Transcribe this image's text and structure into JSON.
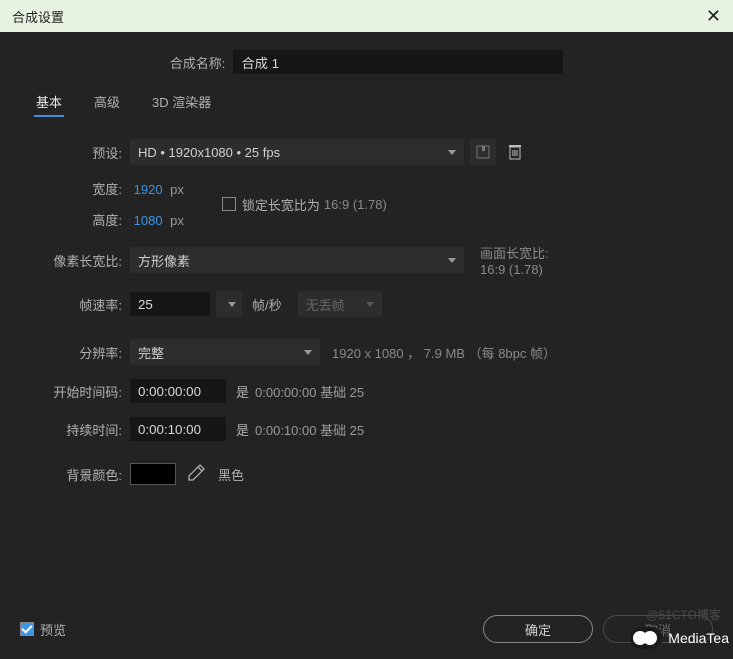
{
  "titlebar": {
    "title": "合成设置"
  },
  "compName": {
    "label": "合成名称:",
    "value": "合成 1"
  },
  "tabs": {
    "basic": "基本",
    "advanced": "高级",
    "renderer": "3D 渲染器"
  },
  "preset": {
    "label": "预设:",
    "value": "HD  •  1920x1080 • 25 fps"
  },
  "width": {
    "label": "宽度:",
    "value": "1920",
    "unit": "px"
  },
  "height": {
    "label": "高度:",
    "value": "1080",
    "unit": "px"
  },
  "lockAspect": {
    "label": "锁定长宽比为",
    "ratio": "16:9 (1.78)"
  },
  "pixelAspect": {
    "label": "像素长宽比:",
    "value": "方形像素",
    "frameAspectLabel": "画面长宽比:",
    "frameAspectValue": "16:9 (1.78)"
  },
  "frameRate": {
    "label": "帧速率:",
    "value": "25",
    "unit": "帧/秒",
    "dropFrame": "无丢帧"
  },
  "resolution": {
    "label": "分辨率:",
    "value": "完整",
    "info": "1920 x 1080 ， 7.9 MB （每 8bpc 帧）"
  },
  "startTimecode": {
    "label": "开始时间码:",
    "value": "0:00:00:00",
    "is": "是",
    "base": "0:00:00:00  基础 25"
  },
  "duration": {
    "label": "持续时间:",
    "value": "0:00:10:00",
    "is": "是",
    "base": "0:00:10:00  基础 25"
  },
  "bgColor": {
    "label": "背景颜色:",
    "name": "黑色",
    "hex": "#000000"
  },
  "footer": {
    "preview": "预览",
    "ok": "确定",
    "cancel": "取消"
  },
  "watermark": {
    "blog": "@51CTO博客",
    "brand": "MediaTea"
  }
}
